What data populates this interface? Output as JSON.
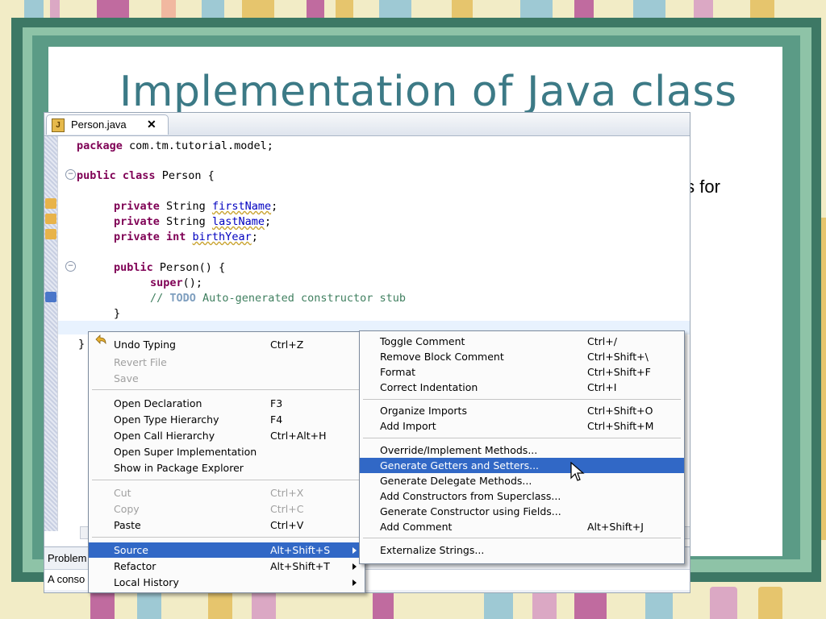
{
  "slide": {
    "title": "Implementation of Java class",
    "caption": "Generating setters and getters for attributes"
  },
  "editor": {
    "tab_label": "Person.java",
    "code": {
      "package_kw": "package",
      "package_rest": " com.tm.tutorial.model;",
      "public_kw": "public",
      "class_kw": " class",
      "class_rest": " Person {",
      "private_kw": "private",
      "string_type": " String ",
      "int_type": " int ",
      "field1": "firstName",
      "field2": "lastName",
      "field3": "birthYear",
      "semicolon": ";",
      "ctor_rest": " Person() {",
      "super_kw": "super",
      "super_rest": "();",
      "comment_prefix": "// ",
      "todo": "TODO",
      "comment_rest": " Auto-generated constructor stub",
      "close_brace": "}"
    },
    "problems_tab": "Problem",
    "problems_row": "A conso"
  },
  "context_menu": {
    "items": [
      {
        "label": "Undo Typing",
        "shortcut": "Ctrl+Z"
      },
      {
        "label": "Revert File",
        "shortcut": ""
      },
      {
        "label": "Save",
        "shortcut": ""
      },
      {
        "label": "Open Declaration",
        "shortcut": "F3"
      },
      {
        "label": "Open Type Hierarchy",
        "shortcut": "F4"
      },
      {
        "label": "Open Call Hierarchy",
        "shortcut": "Ctrl+Alt+H"
      },
      {
        "label": "Open Super Implementation",
        "shortcut": ""
      },
      {
        "label": "Show in Package Explorer",
        "shortcut": ""
      },
      {
        "label": "Cut",
        "shortcut": "Ctrl+X"
      },
      {
        "label": "Copy",
        "shortcut": "Ctrl+C"
      },
      {
        "label": "Paste",
        "shortcut": "Ctrl+V"
      },
      {
        "label": "Source",
        "shortcut": "Alt+Shift+S"
      },
      {
        "label": "Refactor",
        "shortcut": "Alt+Shift+T"
      },
      {
        "label": "Local History",
        "shortcut": ""
      }
    ]
  },
  "source_submenu": {
    "items": [
      {
        "label": "Toggle Comment",
        "shortcut": "Ctrl+/"
      },
      {
        "label": "Remove Block Comment",
        "shortcut": "Ctrl+Shift+\\"
      },
      {
        "label": "Format",
        "shortcut": "Ctrl+Shift+F"
      },
      {
        "label": "Correct Indentation",
        "shortcut": "Ctrl+I"
      },
      {
        "label": "Organize Imports",
        "shortcut": "Ctrl+Shift+O"
      },
      {
        "label": "Add Import",
        "shortcut": "Ctrl+Shift+M"
      },
      {
        "label": "Override/Implement Methods...",
        "shortcut": ""
      },
      {
        "label": "Generate Getters and Setters...",
        "shortcut": ""
      },
      {
        "label": "Generate Delegate Methods...",
        "shortcut": ""
      },
      {
        "label": "Add Constructors from Superclass...",
        "shortcut": ""
      },
      {
        "label": "Generate Constructor using Fields...",
        "shortcut": ""
      },
      {
        "label": "Add Comment",
        "shortcut": "Alt+Shift+J"
      },
      {
        "label": "Externalize Strings...",
        "shortcut": ""
      }
    ]
  },
  "colors": {
    "selection": "#3168c6",
    "title": "#3c7a86",
    "keyword": "#7f0055",
    "field": "#0000c0",
    "comment": "#3f7f5f"
  }
}
